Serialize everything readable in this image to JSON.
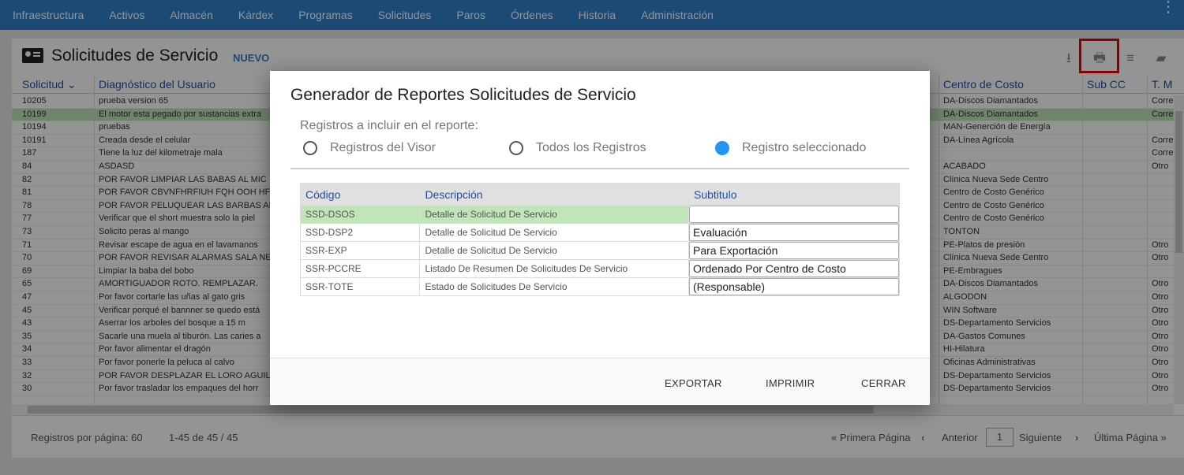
{
  "nav": {
    "items": [
      "Infraestructura",
      "Activos",
      "Almacén",
      "Kárdex",
      "Programas",
      "Solicitudes",
      "Paros",
      "Órdenes",
      "Historia",
      "Administración"
    ],
    "menu_icon": "more-vert-icon"
  },
  "page": {
    "title": "Solicitudes de Servicio",
    "new_label": "NUEVO",
    "toolbar_icons": [
      "download-icon",
      "print-icon",
      "filter-icon",
      "feedback-icon"
    ]
  },
  "table": {
    "headers": [
      "Solicitud",
      "Diagnóstico del Usuario",
      "Centro de Costo",
      "Sub CC",
      "T. M"
    ],
    "sort_indicator": "⌄",
    "rows": [
      {
        "id": "10205",
        "diag": "prueba version 65",
        "cc": "DA-Discos Diamantados",
        "sub": "",
        "tm": "Corre"
      },
      {
        "id": "10199",
        "diag": "El motor esta pegado por sustancias extra",
        "cc": "DA-Discos Diamantados",
        "sub": "",
        "tm": "Corre"
      },
      {
        "id": "10194",
        "diag": "pruebas",
        "cc": "MAN-Generción de Energía",
        "sub": "",
        "tm": ""
      },
      {
        "id": "10191",
        "diag": "Creada desde el celular",
        "cc": "DA-Línea Agrícola",
        "sub": "",
        "tm": "Corre"
      },
      {
        "id": "187",
        "diag": "Tiene la luz del kilometraje mala",
        "cc": "",
        "sub": "",
        "tm": "Corre"
      },
      {
        "id": "84",
        "diag": "ASDASD",
        "cc": "ACABADO",
        "sub": "",
        "tm": "Otro"
      },
      {
        "id": "82",
        "diag": "POR FAVOR LIMPIAR LAS BABAS AL MIC",
        "cc": "Clínica Nueva Sede Centro",
        "sub": "",
        "tm": ""
      },
      {
        "id": "81",
        "diag": "POR FAVOR CBVNFHRFIUH FQH OOH HF",
        "cc": "Centro de Costo Genérico",
        "sub": "",
        "tm": ""
      },
      {
        "id": "78",
        "diag": "POR FAVOR PELUQUEAR LAS BARBAS AL",
        "cc": "Centro de Costo Genérico",
        "sub": "",
        "tm": ""
      },
      {
        "id": "77",
        "diag": "Verificar que el short muestra solo la piel",
        "cc": "Centro de Costo Genérico",
        "sub": "",
        "tm": ""
      },
      {
        "id": "73",
        "diag": "Solicito peras al mango",
        "cc": "TONTON",
        "sub": "",
        "tm": ""
      },
      {
        "id": "71",
        "diag": "Revisar escape de agua en el lavamanos",
        "cc": "PE-Platos de presión",
        "sub": "",
        "tm": "Otro"
      },
      {
        "id": "70",
        "diag": "POR FAVOR REVISAR ALARMAS SALA NE",
        "cc": "Clínica Nueva Sede Centro",
        "sub": "",
        "tm": "Otro"
      },
      {
        "id": "69",
        "diag": "Limpiar la baba del bobo",
        "cc": "PE-Embragues",
        "sub": "",
        "tm": ""
      },
      {
        "id": "65",
        "diag": "AMORTIGUADOR ROTO. REMPLAZAR.",
        "cc": "DA-Discos Diamantados",
        "sub": "",
        "tm": "Otro"
      },
      {
        "id": "47",
        "diag": "Por favor cortarle las uñas al gato gris",
        "cc": "ALGODON",
        "sub": "",
        "tm": "Otro"
      },
      {
        "id": "45",
        "diag": "Verificar porqué el bannner se quedo está",
        "cc": "WIN Software",
        "sub": "",
        "tm": "Otro"
      },
      {
        "id": "43",
        "diag": "Aserrar los arboles del bosque a 15 m",
        "cc": "DS-Departamento Servicios",
        "sub": "",
        "tm": "Otro"
      },
      {
        "id": "35",
        "diag": "Sacarle una muela al tiburón. Las caries a",
        "cc": "DA-Gastos Comunes",
        "sub": "",
        "tm": "Otro"
      },
      {
        "id": "34",
        "diag": "Por favor alimentar el dragón",
        "cc": "HI-Hilatura",
        "sub": "",
        "tm": "Otro"
      },
      {
        "id": "33",
        "diag": "Por favor ponerle la peluca al calvo",
        "cc": "Oficinas Administrativas",
        "sub": "",
        "tm": "Otro"
      },
      {
        "id": "32",
        "diag": "POR FAVOR DESPLAZAR EL LORO AGUIL",
        "cc": "DS-Departamento Servicios",
        "sub": "",
        "tm": "Otro"
      },
      {
        "id": "30",
        "diag": "Por favor trasladar los empaques del horr",
        "cc": "DS-Departamento Servicios",
        "sub": "",
        "tm": "Otro"
      }
    ],
    "selected_row": 1
  },
  "footer": {
    "per_page": "Registros por página: 60",
    "range": "1-45 de 45 / 45",
    "first": "« Primera Página",
    "prev": "Anterior",
    "page": "1",
    "next": "Siguiente",
    "last": "Última Página »"
  },
  "dialog": {
    "title": "Generador de Reportes Solicitudes de Servicio",
    "subtitle": "Registros a incluir en el reporte:",
    "options": [
      {
        "label": "Registros del Visor",
        "selected": false
      },
      {
        "label": "Todos los Registros",
        "selected": false
      },
      {
        "label": "Registro seleccionado",
        "selected": true
      }
    ],
    "headers": [
      "Código",
      "Descripción",
      "Subtitulo"
    ],
    "reports": [
      {
        "code": "SSD-DSOS",
        "desc": "Detalle de Solicitud De Servicio",
        "sub": ""
      },
      {
        "code": "SSD-DSP2",
        "desc": "Detalle de Solicitud De Servicio",
        "sub": "Evaluación"
      },
      {
        "code": "SSR-EXP",
        "desc": "Detalle de Solicitud De Servicio",
        "sub": "Para Exportación"
      },
      {
        "code": "SSR-PCCRE",
        "desc": "Listado De Resumen De Solicitudes De Servicio",
        "sub": "Ordenado Por Centro de Costo"
      },
      {
        "code": "SSR-TOTE",
        "desc": "Estado de Solicitudes De Servicio",
        "sub": "(Responsable)"
      }
    ],
    "selected_report": 0,
    "buttons": {
      "export": "EXPORTAR",
      "print": "IMPRIMIR",
      "close": "CERRAR"
    }
  },
  "colors": {
    "nav": "#2f80c9",
    "accent": "#2196f3",
    "selected_row": "#bfe5b9",
    "header_text": "#1f4fa8",
    "highlight": "#e00000"
  }
}
